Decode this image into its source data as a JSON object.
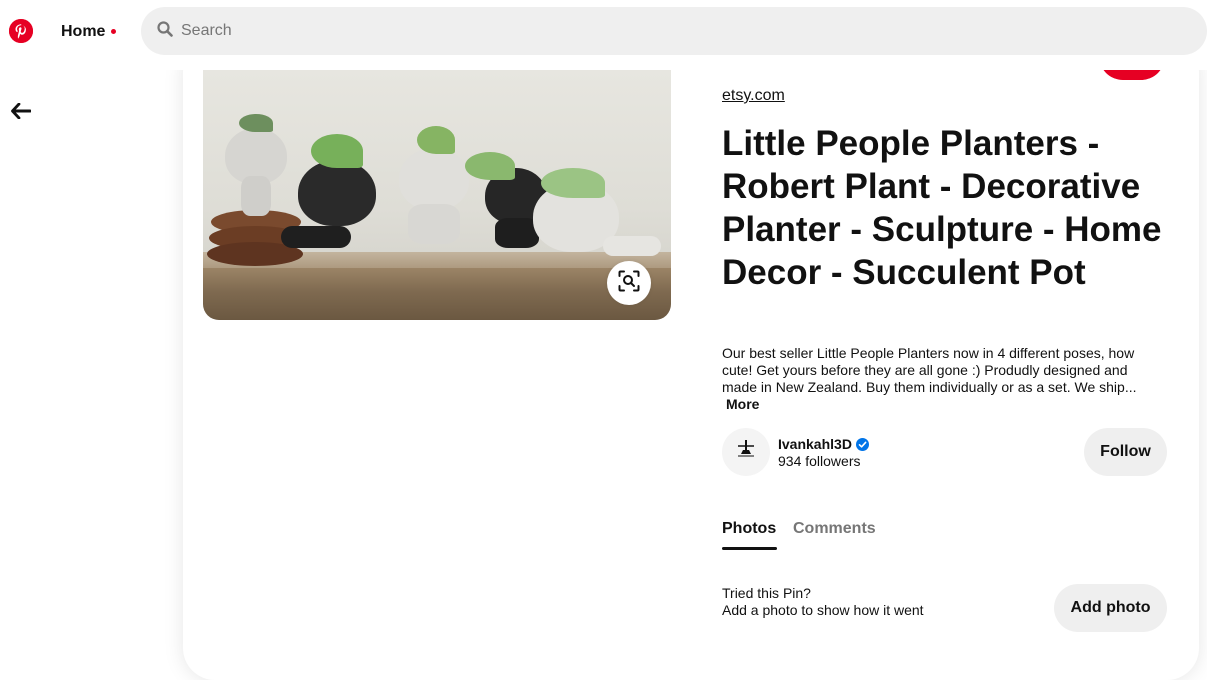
{
  "header": {
    "home_label": "Home",
    "search_placeholder": "Search"
  },
  "pin": {
    "source": "etsy.com",
    "title": "Little People Planters - Robert Plant - Decorative Planter - Sculpture - Home Decor - Succulent Pot",
    "description": "Our best seller Little People Planters now in 4 different poses, how cute! Get yours before they are all gone :) Produdly designed and made in New Zealand. Buy them individually or as a set. We ship...",
    "more_label": "More"
  },
  "creator": {
    "name": "Ivankahl3D",
    "avatar_text": "Ivankahl 3D",
    "followers": "934 followers",
    "follow_label": "Follow"
  },
  "tabs": [
    {
      "label": "Photos",
      "active": true
    },
    {
      "label": "Comments",
      "active": false
    }
  ],
  "tried": {
    "title": "Tried this Pin?",
    "subtitle": "Add a photo to show how it went",
    "button_label": "Add photo"
  },
  "colors": {
    "brand": "#e60023",
    "button_bg": "#efefef",
    "verified": "#0074e8"
  }
}
